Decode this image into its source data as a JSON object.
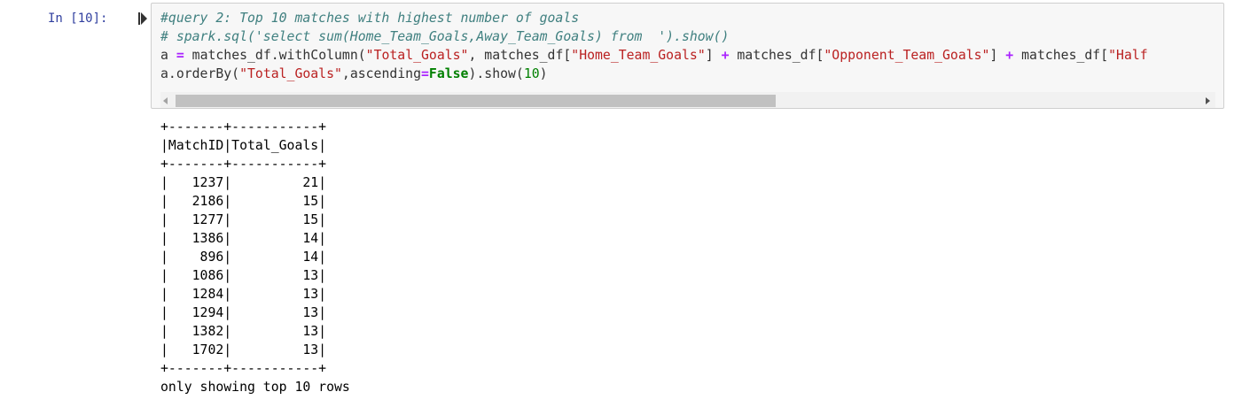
{
  "cell": {
    "prompt": "In [10]:",
    "code_lines": [
      [
        {
          "t": "#query 2: Top 10 matches with highest number of goals",
          "c": "cm-comment"
        }
      ],
      [
        {
          "t": "# spark.sql('select sum(Home_Team_Goals,Away_Team_Goals) from  ').show()",
          "c": "cm-comment"
        }
      ],
      [
        {
          "t": "a ",
          "c": ""
        },
        {
          "t": "=",
          "c": "cm-op"
        },
        {
          "t": " matches_df.withColumn(",
          "c": ""
        },
        {
          "t": "\"Total_Goals\"",
          "c": "cm-string"
        },
        {
          "t": ", matches_df[",
          "c": ""
        },
        {
          "t": "\"Home_Team_Goals\"",
          "c": "cm-string"
        },
        {
          "t": "] ",
          "c": ""
        },
        {
          "t": "+",
          "c": "cm-op"
        },
        {
          "t": " matches_df[",
          "c": ""
        },
        {
          "t": "\"Opponent_Team_Goals\"",
          "c": "cm-string"
        },
        {
          "t": "] ",
          "c": ""
        },
        {
          "t": "+",
          "c": "cm-op"
        },
        {
          "t": " matches_df[",
          "c": ""
        },
        {
          "t": "\"Half",
          "c": "cm-string"
        }
      ],
      [
        {
          "t": "a.orderBy(",
          "c": ""
        },
        {
          "t": "\"Total_Goals\"",
          "c": "cm-string"
        },
        {
          "t": ",ascending",
          "c": ""
        },
        {
          "t": "=",
          "c": "cm-op"
        },
        {
          "t": "False",
          "c": "cm-keyword"
        },
        {
          "t": ").show(",
          "c": ""
        },
        {
          "t": "10",
          "c": "cm-number"
        },
        {
          "t": ")",
          "c": ""
        }
      ]
    ]
  },
  "output": {
    "lines": [
      "+-------+-----------+",
      "|MatchID|Total_Goals|",
      "+-------+-----------+",
      "|   1237|         21|",
      "|   2186|         15|",
      "|   1277|         15|",
      "|   1386|         14|",
      "|    896|         14|",
      "|   1086|         13|",
      "|   1284|         13|",
      "|   1294|         13|",
      "|   1382|         13|",
      "|   1702|         13|",
      "+-------+-----------+",
      "only showing top 10 rows"
    ]
  },
  "icons": {
    "run": "run-cell-icon",
    "scroll_left": "scroll-left-icon",
    "scroll_right": "scroll-right-icon"
  },
  "colors": {
    "prompt": "#303f9f",
    "comment": "#408080",
    "string": "#ba2121",
    "operator": "#aa22ff",
    "keyword": "#008000",
    "cell_bg": "#f7f7f7",
    "cell_border": "#cfcfcf"
  }
}
